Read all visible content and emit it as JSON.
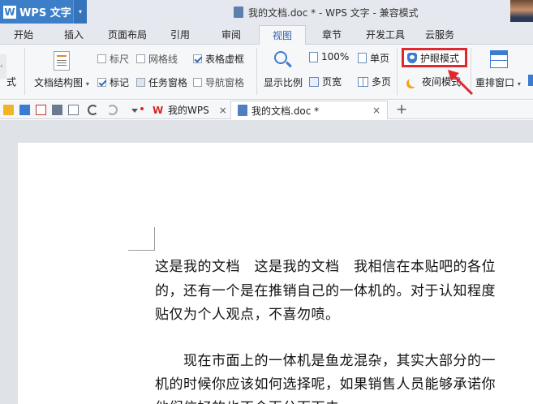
{
  "app": {
    "name": "WPS 文字",
    "logo": "W",
    "dropdown_glyph": "▾"
  },
  "window": {
    "title": "我的文档.doc * - WPS 文字 - 兼容模式"
  },
  "tabs": [
    "开始",
    "插入",
    "页面布局",
    "引用",
    "审阅",
    "视图",
    "章节",
    "开发工具",
    "云服务"
  ],
  "active_tab": "视图",
  "ribbon": {
    "left_cut_label": "式",
    "doc_structure_label": "文档结构图",
    "doc_structure_arrow": "▾",
    "ruler": "标尺",
    "gridlines": "网格线",
    "table_lines": "表格虚框",
    "markers": "标记",
    "task_pane": "任务窗格",
    "nav_pane": "导航窗格",
    "zoom_label": "显示比例",
    "zoom_100": "100%",
    "page_width": "页宽",
    "single_page": "单页",
    "multi_page": "多页",
    "eye_care": "护眼模式",
    "night_mode": "夜间模式",
    "arrange_windows": "重排窗口",
    "arrange_arrow": "▾",
    "checks": {
      "ruler": false,
      "gridlines": false,
      "table_lines": true,
      "markers": true,
      "task_pane": false,
      "nav_pane": false
    }
  },
  "toolbar": {
    "doc_tabs": [
      {
        "label": "我的WPS",
        "close": "×"
      },
      {
        "label": "我的文档.doc *",
        "close": "×"
      }
    ],
    "new_tab": "+"
  },
  "document": {
    "lines": [
      "这是我的文档　这是我的文档　我相信在本贴吧的各位",
      "的，还有一个是在推销自己的一体机的。对于认知程度",
      "贴仅为个人观点，不喜勿喷。",
      "",
      "　　现在市面上的一体机是鱼龙混杂，其实大部分的一",
      "机的时候你应该如何选择呢，如果销售人员能够承诺你",
      "他们信好的也不会百分百下去"
    ]
  },
  "colors": {
    "accent": "#3c7fc8",
    "highlight": "#e3262b"
  }
}
